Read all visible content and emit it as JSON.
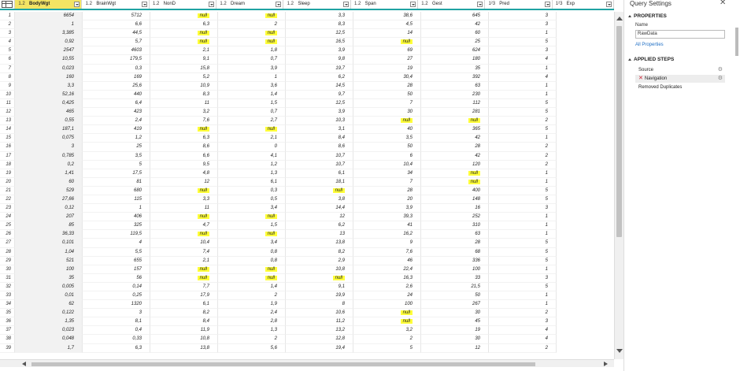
{
  "columns": [
    {
      "type": "1.2",
      "name": "BodyWgt",
      "selected": true
    },
    {
      "type": "1.2",
      "name": "BrainWgt"
    },
    {
      "type": "1.2",
      "name": "NonD"
    },
    {
      "type": "1.2",
      "name": "Dream"
    },
    {
      "type": "1.2",
      "name": "Sleep"
    },
    {
      "type": "1.2",
      "name": "Span"
    },
    {
      "type": "1.2",
      "name": "Gest"
    },
    {
      "type": "1²3",
      "name": "Pred"
    },
    {
      "type": "1²3",
      "name": "Exp"
    }
  ],
  "rows": [
    [
      "1",
      "6654",
      "5712",
      "null",
      "null",
      "3,3",
      "38,6",
      "645",
      "3"
    ],
    [
      "2",
      "1",
      "6,6",
      "6,3",
      "2",
      "8,3",
      "4,5",
      "42",
      "3"
    ],
    [
      "3",
      "3,385",
      "44,5",
      "null",
      "null",
      "12,5",
      "14",
      "60",
      "1"
    ],
    [
      "4",
      "0,92",
      "5,7",
      "null",
      "null",
      "16,5",
      "null",
      "25",
      "5"
    ],
    [
      "5",
      "2547",
      "4603",
      "2,1",
      "1,8",
      "3,9",
      "69",
      "624",
      "3"
    ],
    [
      "6",
      "10,55",
      "179,5",
      "9,1",
      "0,7",
      "9,8",
      "27",
      "180",
      "4"
    ],
    [
      "7",
      "0,023",
      "0,3",
      "15,8",
      "3,9",
      "19,7",
      "19",
      "35",
      "1"
    ],
    [
      "8",
      "160",
      "169",
      "5,2",
      "1",
      "6,2",
      "30,4",
      "392",
      "4"
    ],
    [
      "9",
      "3,3",
      "25,6",
      "10,9",
      "3,6",
      "14,5",
      "28",
      "63",
      "1"
    ],
    [
      "10",
      "52,16",
      "440",
      "8,3",
      "1,4",
      "9,7",
      "50",
      "230",
      "1"
    ],
    [
      "11",
      "0,425",
      "6,4",
      "11",
      "1,5",
      "12,5",
      "7",
      "112",
      "5"
    ],
    [
      "12",
      "465",
      "423",
      "3,2",
      "0,7",
      "3,9",
      "30",
      "281",
      "5"
    ],
    [
      "13",
      "0,55",
      "2,4",
      "7,6",
      "2,7",
      "10,3",
      "null",
      "null",
      "2"
    ],
    [
      "14",
      "187,1",
      "419",
      "null",
      "null",
      "3,1",
      "40",
      "365",
      "5"
    ],
    [
      "15",
      "0,075",
      "1,2",
      "6,3",
      "2,1",
      "8,4",
      "3,5",
      "42",
      "1"
    ],
    [
      "16",
      "3",
      "25",
      "8,6",
      "0",
      "8,6",
      "50",
      "28",
      "2"
    ],
    [
      "17",
      "0,785",
      "3,5",
      "6,6",
      "4,1",
      "10,7",
      "6",
      "42",
      "2"
    ],
    [
      "18",
      "0,2",
      "5",
      "9,5",
      "1,2",
      "10,7",
      "10,4",
      "120",
      "2"
    ],
    [
      "19",
      "1,41",
      "17,5",
      "4,8",
      "1,3",
      "6,1",
      "34",
      "null",
      "1"
    ],
    [
      "20",
      "60",
      "81",
      "12",
      "6,1",
      "18,1",
      "7",
      "null",
      "1"
    ],
    [
      "21",
      "529",
      "680",
      "null",
      "0,3",
      "null",
      "28",
      "400",
      "5"
    ],
    [
      "22",
      "27,66",
      "115",
      "3,3",
      "0,5",
      "3,8",
      "20",
      "148",
      "5"
    ],
    [
      "23",
      "0,12",
      "1",
      "11",
      "3,4",
      "14,4",
      "3,9",
      "16",
      "3"
    ],
    [
      "24",
      "207",
      "406",
      "null",
      "null",
      "12",
      "39,3",
      "252",
      "1"
    ],
    [
      "25",
      "85",
      "325",
      "4,7",
      "1,5",
      "6,2",
      "41",
      "310",
      "1"
    ],
    [
      "26",
      "36,33",
      "119,5",
      "null",
      "null",
      "13",
      "16,2",
      "63",
      "1"
    ],
    [
      "27",
      "0,101",
      "4",
      "10,4",
      "3,4",
      "13,8",
      "9",
      "28",
      "5"
    ],
    [
      "28",
      "1,04",
      "5,5",
      "7,4",
      "0,8",
      "8,2",
      "7,6",
      "68",
      "5"
    ],
    [
      "29",
      "521",
      "655",
      "2,1",
      "0,8",
      "2,9",
      "46",
      "336",
      "5"
    ],
    [
      "30",
      "100",
      "157",
      "null",
      "null",
      "10,8",
      "22,4",
      "100",
      "1"
    ],
    [
      "31",
      "35",
      "56",
      "null",
      "null",
      "null",
      "16,3",
      "33",
      "3"
    ],
    [
      "32",
      "0,005",
      "0,14",
      "7,7",
      "1,4",
      "9,1",
      "2,6",
      "21,5",
      "5"
    ],
    [
      "33",
      "0,01",
      "0,25",
      "17,9",
      "2",
      "19,9",
      "24",
      "50",
      "1"
    ],
    [
      "34",
      "62",
      "1320",
      "6,1",
      "1,9",
      "8",
      "100",
      "267",
      "1"
    ],
    [
      "35",
      "0,122",
      "3",
      "8,2",
      "2,4",
      "10,6",
      "null",
      "30",
      "2"
    ],
    [
      "36",
      "1,35",
      "8,1",
      "8,4",
      "2,8",
      "11,2",
      "null",
      "45",
      "3"
    ],
    [
      "37",
      "0,023",
      "0,4",
      "11,9",
      "1,3",
      "13,2",
      "3,2",
      "19",
      "4"
    ],
    [
      "38",
      "0,048",
      "0,33",
      "10,8",
      "2",
      "12,8",
      "2",
      "30",
      "4"
    ],
    [
      "39",
      "1,7",
      "6,3",
      "13,8",
      "5,6",
      "19,4",
      "5",
      "12",
      "2"
    ]
  ],
  "settings": {
    "title": "Query Settings",
    "close": "✕",
    "properties_title": "PROPERTIES",
    "name_label": "Name",
    "name_value": "RawData",
    "all_properties": "All Properties",
    "applied_steps_title": "APPLIED STEPS",
    "steps": [
      {
        "label": "Source",
        "gear": true
      },
      {
        "label": "Navigation",
        "gear": true,
        "active": true,
        "error": true
      },
      {
        "label": "Removed Duplicates",
        "gear": false
      }
    ]
  }
}
